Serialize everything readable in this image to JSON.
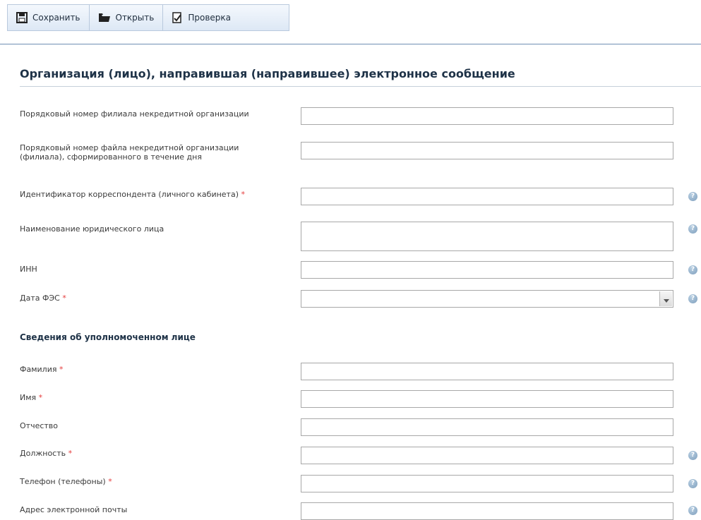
{
  "toolbar": {
    "save_label": "Сохранить",
    "open_label": "Открыть",
    "check_label": "Проверка"
  },
  "section": {
    "title": "Организация (лицо), направившая (направившее) электронное сообщение"
  },
  "fields": {
    "branch_number": {
      "label": "Порядковый номер филиала некредитной организации",
      "value": ""
    },
    "file_number": {
      "label": "Порядковый номер файла некредитной организации (филиала), сформированного в течение дня",
      "value": ""
    },
    "correspondent_id": {
      "label": "Идентификатор корреспондента (личного кабинета)",
      "required": "*",
      "value": ""
    },
    "legal_name": {
      "label": "Наименование юридического лица",
      "value": ""
    },
    "inn": {
      "label": "ИНН",
      "value": ""
    },
    "fes_date": {
      "label": "Дата ФЭС",
      "required": "*",
      "value": ""
    }
  },
  "subsection": {
    "title": "Сведения об уполномоченном лице"
  },
  "person": {
    "surname": {
      "label": "Фамилия",
      "required": "*",
      "value": ""
    },
    "name": {
      "label": "Имя",
      "required": "*",
      "value": ""
    },
    "patronymic": {
      "label": "Отчество",
      "value": ""
    },
    "position": {
      "label": "Должность",
      "required": "*",
      "value": ""
    },
    "phone": {
      "label": "Телефон (телефоны)",
      "required": "*",
      "value": ""
    },
    "email": {
      "label": "Адрес электронной почты",
      "value": ""
    }
  },
  "help_glyph": "?",
  "colors": {
    "toolbar_border": "#b9c9dd",
    "accent_rule": "#6f8fb4",
    "required": "#e53c3c",
    "help_icon": "#8fadc8"
  },
  "icons": {
    "save": "floppy-disk-icon",
    "open": "folder-icon",
    "check": "document-check-icon",
    "help": "help-icon",
    "dropdown": "chevron-down-icon"
  }
}
